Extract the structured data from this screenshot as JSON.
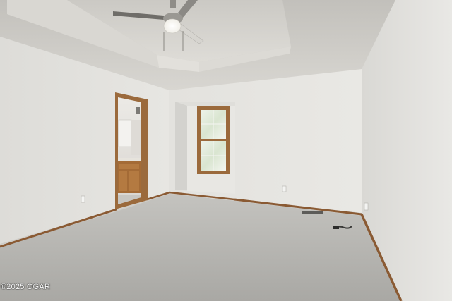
{
  "photo": {
    "watermark": "©2025 OGAR"
  },
  "colors": {
    "wall_light": "#e6e5e1",
    "wall_shadow": "#c9c8c3",
    "ceiling": "#d3d1cc",
    "carpet": "#b8b7b3",
    "trim_wood": "#8a5a33",
    "window_frame": "#9b6a3c"
  },
  "icons": {
    "fan": "ceiling-fan-icon",
    "window": "window-icon"
  }
}
